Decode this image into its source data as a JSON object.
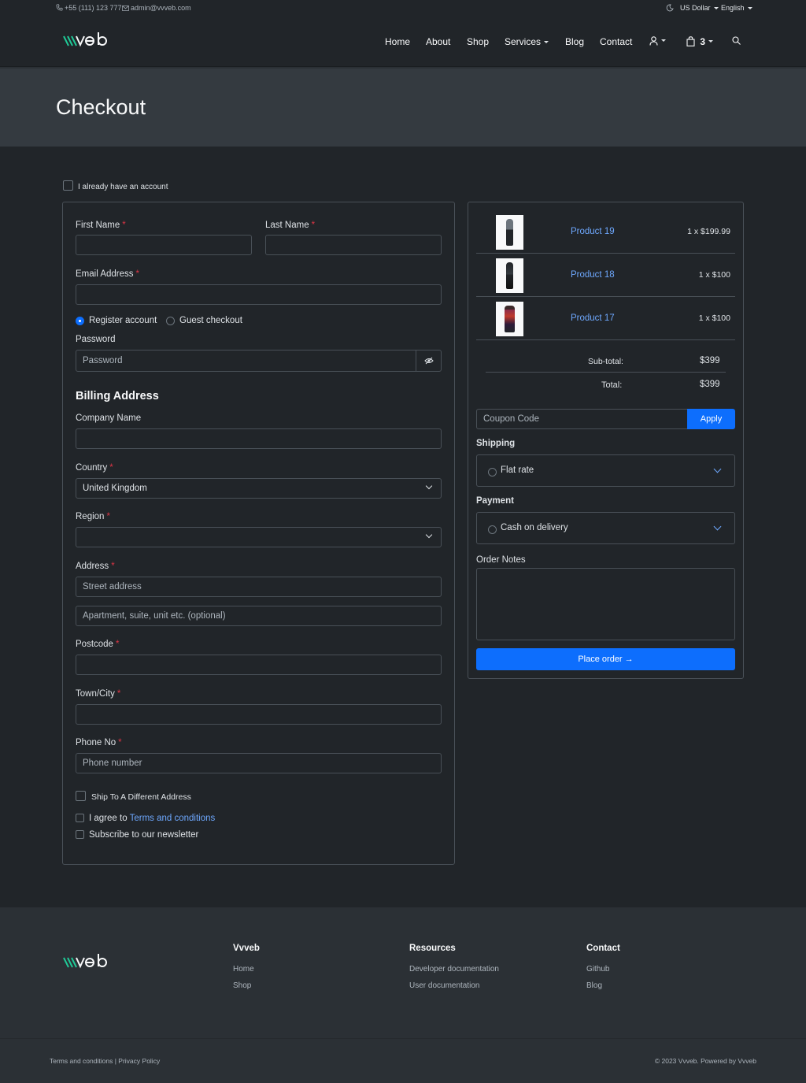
{
  "topbar": {
    "phone": "+55 (111) 123 777",
    "email": "admin@vvveb.com",
    "currency": "US Dollar",
    "language": "English"
  },
  "brand": {
    "logo_v": "\\\\\\v",
    "logo_rest": "eb"
  },
  "nav": {
    "home": "Home",
    "about": "About",
    "shop": "Shop",
    "services": "Services",
    "blog": "Blog",
    "contact": "Contact",
    "cart_count": "3"
  },
  "page_title": "Checkout",
  "account": {
    "already_have": "I already have an account"
  },
  "form": {
    "first_name": "First Name",
    "last_name": "Last Name",
    "email": "Email Address",
    "register_account": "Register account",
    "guest_checkout": "Guest checkout",
    "password_label": "Password",
    "password_placeholder": "Password",
    "billing_heading": "Billing Address",
    "company": "Company Name",
    "country": "Country",
    "country_value": "United Kingdom",
    "region": "Region",
    "address": "Address",
    "street_placeholder": "Street address",
    "apartment_placeholder": "Apartment, suite, unit etc. (optional)",
    "postcode": "Postcode",
    "town": "Town/City",
    "phone": "Phone No",
    "phone_placeholder": "Phone number",
    "ship_different": "Ship To A Different Address",
    "agree_prefix": "I agree to",
    "terms_link": "Terms and conditions",
    "subscribe": "Subscribe to our newsletter"
  },
  "order": {
    "products": [
      {
        "name": "Product 19",
        "price": "1 x $199.99"
      },
      {
        "name": "Product 18",
        "price": "1 x $100"
      },
      {
        "name": "Product 17",
        "price": "1 x $100"
      }
    ],
    "subtotal_label": "Sub-total:",
    "subtotal": "$399",
    "total_label": "Total:",
    "total": "$399",
    "coupon_placeholder": "Coupon Code",
    "apply": "Apply",
    "shipping_heading": "Shipping",
    "shipping_option": "Flat rate",
    "payment_heading": "Payment",
    "payment_option": "Cash on delivery",
    "notes_label": "Order Notes",
    "place_order": "Place order →"
  },
  "footer": {
    "col1": {
      "heading": "Vvveb",
      "links": [
        "Home",
        "Shop"
      ]
    },
    "col2": {
      "heading": "Resources",
      "links": [
        "Developer documentation",
        "User documentation"
      ]
    },
    "col3": {
      "heading": "Contact",
      "links": [
        "Github",
        "Blog"
      ]
    },
    "terms": "Terms and conditions",
    "separator": "|",
    "privacy": "Privacy Policy",
    "copyright": "© 2023 Vvveb. Powered by Vvveb"
  },
  "colors": {
    "accent": "#0d6efd",
    "link": "#6ea8fe",
    "brand_green": "#20c997",
    "required": "#dc3545"
  },
  "icons": [
    "phone-icon",
    "mail-icon",
    "theme-toggle-icon",
    "user-icon",
    "bag-icon",
    "search-icon",
    "eye-slash-icon",
    "chevron-down-icon",
    "arrow-right-icon"
  ]
}
